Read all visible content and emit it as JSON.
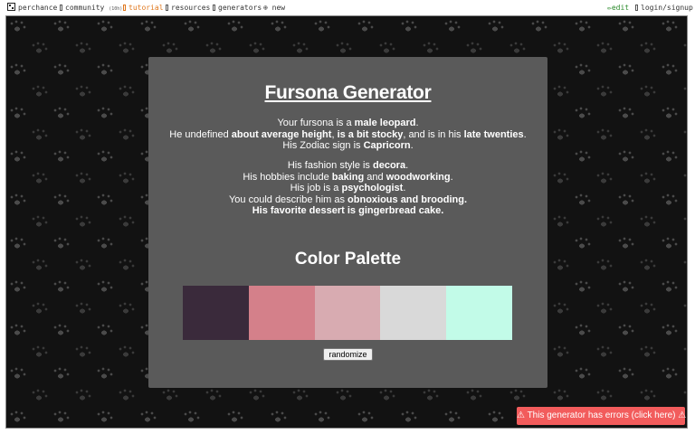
{
  "nav": {
    "brand": "perchance",
    "community": "community",
    "community_count": "(10h)",
    "tutorial": "tutorial",
    "resources": "resources",
    "generators": "generators",
    "new": "new",
    "edit": "edit",
    "login": "login/signup"
  },
  "card": {
    "title": "Fursona Generator",
    "lines_1": [
      [
        "Your fursona is a ",
        "male leopard",
        "."
      ],
      [
        "He undefined ",
        "about average height",
        ", ",
        "is a bit stocky",
        ", and is in his ",
        "late twenties",
        "."
      ],
      [
        "His Zodiac sign is ",
        "Capricorn",
        "."
      ]
    ],
    "lines_2": [
      [
        "His fashion style is ",
        "decora",
        "."
      ],
      [
        "His hobbies include ",
        "baking",
        " and ",
        "woodworking",
        "."
      ],
      [
        "His job is a ",
        "psychologist",
        "."
      ],
      [
        "You could describe him as ",
        "obnoxious and brooding."
      ],
      [
        "",
        "His favorite dessert is gingerbread cake."
      ]
    ],
    "palette_title": "Color Palette",
    "palette": [
      "#3a2a3b",
      "#d4808a",
      "#d8abb1",
      "#d9d9d9",
      "#c2fbe8"
    ],
    "randomize_label": "randomize"
  },
  "error": {
    "label": "⚠ This generator has errors (click here) ⚠"
  }
}
